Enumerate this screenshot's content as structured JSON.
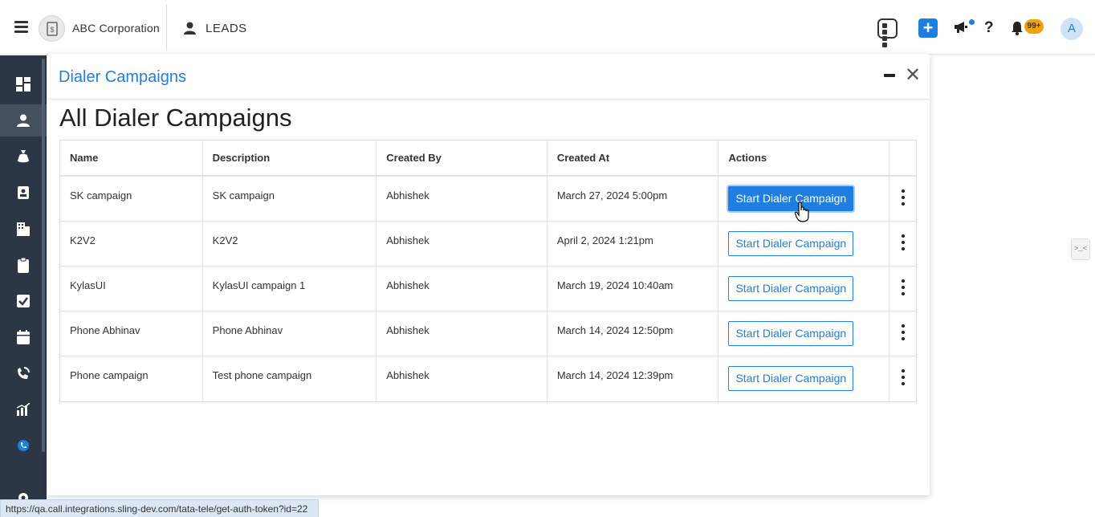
{
  "header": {
    "company_name": "ABC Corporation",
    "module_label": "LEADS",
    "notification_count": "99+",
    "avatar_initial": "A",
    "help_label": "?"
  },
  "modal": {
    "title": "Dialer Campaigns",
    "heading": "All Dialer Campaigns",
    "close_label": "✕"
  },
  "table": {
    "columns": [
      "Name",
      "Description",
      "Created By",
      "Created At",
      "Actions",
      ""
    ],
    "rows": [
      {
        "name": "SK campaign",
        "description": "SK campaign",
        "created_by": "Abhishek",
        "created_at": "March 27, 2024 5:00pm",
        "action": "Start Dialer Campaign"
      },
      {
        "name": "K2V2",
        "description": "K2V2",
        "created_by": "Abhishek",
        "created_at": "April 2, 2024 1:21pm",
        "action": "Start Dialer Campaign"
      },
      {
        "name": "KylasUI",
        "description": "KylasUI campaign 1",
        "created_by": "Abhishek",
        "created_at": "March 19, 2024 10:40am",
        "action": "Start Dialer Campaign"
      },
      {
        "name": "Phone Abhinav",
        "description": "Phone Abhinav",
        "created_by": "Abhishek",
        "created_at": "March 14, 2024 12:50pm",
        "action": "Start Dialer Campaign"
      },
      {
        "name": "Phone campaign",
        "description": "Test phone campaign",
        "created_by": "Abhishek",
        "created_at": "March 14, 2024 12:39pm",
        "action": "Start Dialer Campaign"
      }
    ]
  },
  "side_toggle_label": ">_<",
  "status_url": "https://qa.call.integrations.sling-dev.com/tata-tele/get-auth-token?id=22",
  "colors": {
    "accent": "#1e7fe0",
    "sidebar": "#2d3644",
    "badge": "#f0a30a"
  }
}
